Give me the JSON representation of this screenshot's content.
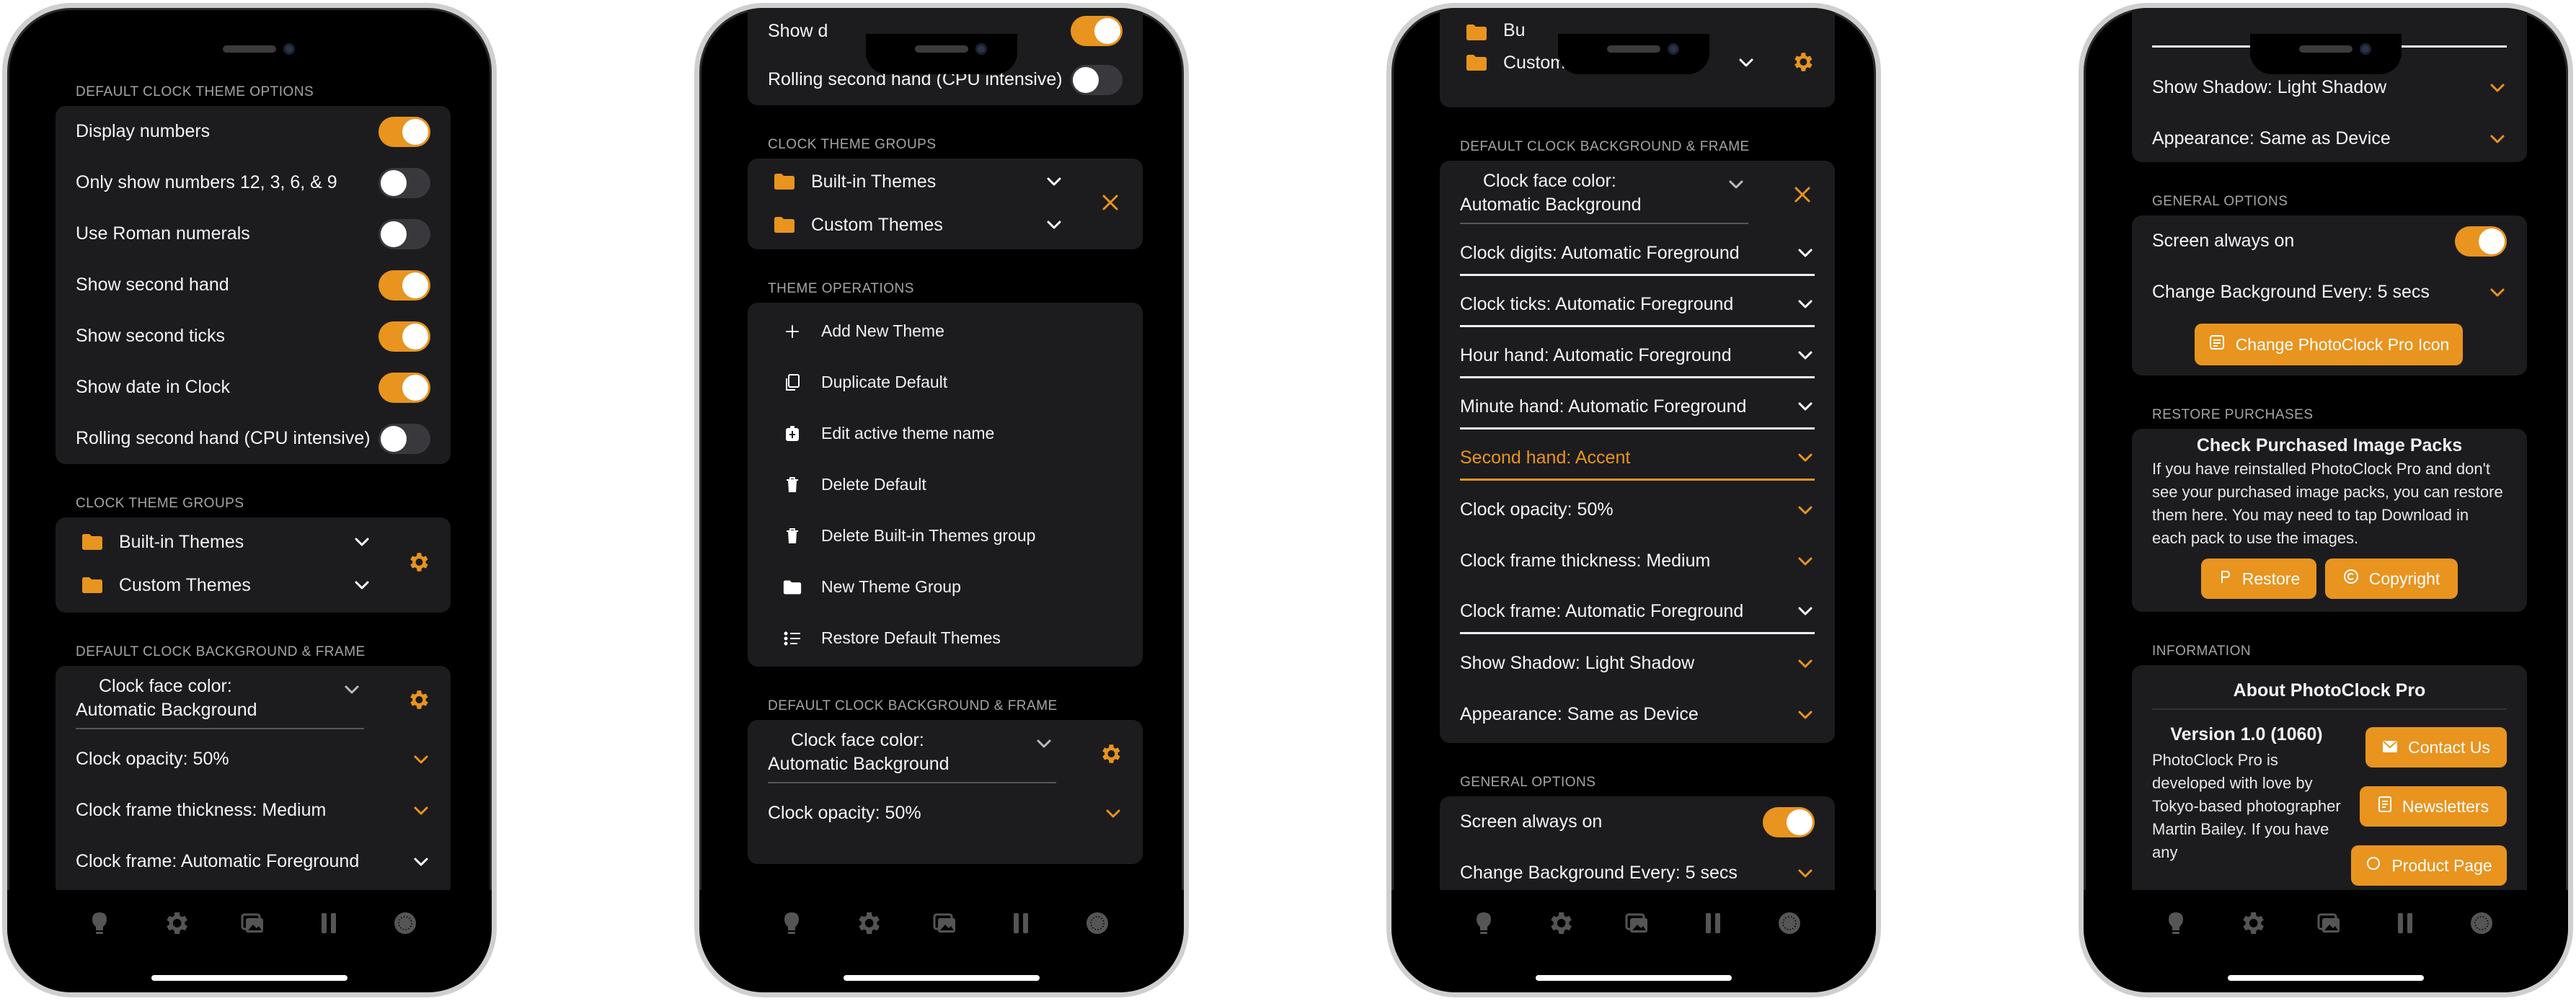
{
  "accent": "#e8941f",
  "phone1": {
    "default_theme_header": "DEFAULT CLOCK THEME OPTIONS",
    "toggles": [
      {
        "label": "Display numbers",
        "on": true
      },
      {
        "label": "Only show numbers 12, 3, 6, & 9",
        "on": false
      },
      {
        "label": "Use Roman numerals",
        "on": false
      },
      {
        "label": "Show second hand",
        "on": true
      },
      {
        "label": "Show second ticks",
        "on": true
      },
      {
        "label": "Show date in Clock",
        "on": true
      },
      {
        "label": "Rolling second hand (CPU intensive)",
        "on": false
      }
    ],
    "groups_header": "CLOCK THEME GROUPS",
    "groups": [
      "Built-in Themes",
      "Custom Themes"
    ],
    "bg_header": "DEFAULT CLOCK BACKGROUND & FRAME",
    "face_color_line1": "Clock face color:",
    "face_color_line2": "Automatic Background",
    "opacity": "Clock opacity: 50%",
    "frame_thickness": "Clock frame thickness: Medium",
    "frame": "Clock frame: Automatic Foreground"
  },
  "phone2": {
    "partial_top": "Show d",
    "rolling": "Rolling second hand (CPU intensive)",
    "groups_header": "CLOCK THEME GROUPS",
    "groups": [
      "Built-in Themes",
      "Custom Themes"
    ],
    "ops_header": "THEME OPERATIONS",
    "operations": [
      {
        "label": "Add New Theme",
        "icon": "plus-icon"
      },
      {
        "label": "Duplicate Default",
        "icon": "duplicate-icon"
      },
      {
        "label": "Edit active theme name",
        "icon": "edit-icon"
      },
      {
        "label": "Delete Default",
        "icon": "trash-icon"
      },
      {
        "label": "Delete Built-in Themes group",
        "icon": "trash-icon"
      },
      {
        "label": "New Theme Group",
        "icon": "folder-icon"
      },
      {
        "label": "Restore Default Themes",
        "icon": "restore-list-icon"
      }
    ],
    "bg_header": "DEFAULT CLOCK BACKGROUND & FRAME",
    "face_color_line1": "Clock face color:",
    "face_color_line2": "Automatic Background",
    "opacity": "Clock opacity: 50%"
  },
  "phone3": {
    "partial_group": "Bu",
    "custom_group": "Custom Themes",
    "bg_header": "DEFAULT CLOCK BACKGROUND & FRAME",
    "face_color_line1": "Clock face color:",
    "face_color_line2": "Automatic Background",
    "rows": [
      {
        "label": "Clock digits: Automatic Foreground",
        "style": "white"
      },
      {
        "label": "Clock ticks: Automatic Foreground",
        "style": "white"
      },
      {
        "label": "Hour hand: Automatic Foreground",
        "style": "white"
      },
      {
        "label": "Minute hand: Automatic Foreground",
        "style": "white"
      },
      {
        "label": "Second hand: Accent",
        "style": "accent"
      },
      {
        "label": "Clock opacity: 50%",
        "style": "plain"
      },
      {
        "label": "Clock frame thickness: Medium",
        "style": "plain"
      },
      {
        "label": "Clock frame: Automatic Foreground",
        "style": "white"
      },
      {
        "label": "Show Shadow: Light Shadow",
        "style": "plain"
      },
      {
        "label": "Appearance: Same as Device",
        "style": "plain"
      }
    ],
    "general_header": "GENERAL OPTIONS",
    "screen_on": "Screen always on",
    "change_bg_partial": "Change Background Every: 5 secs"
  },
  "phone4": {
    "shadow": "Show Shadow: Light Shadow",
    "appearance": "Appearance: Same as Device",
    "general_header": "GENERAL OPTIONS",
    "screen_on": "Screen always on",
    "change_bg": "Change Background Every: 5 secs",
    "change_icon_btn": "Change PhotoClock Pro Icon",
    "restore_header": "RESTORE PURCHASES",
    "check_title": "Check Purchased Image Packs",
    "check_text": "If you have reinstalled PhotoClock Pro and don't see your purchased image packs, you can restore them here. You may need to tap Download in each pack to use the images.",
    "restore_btn": "Restore",
    "copyright_btn": "Copyright",
    "info_header": "INFORMATION",
    "about_title": "About PhotoClock Pro",
    "version": "Version 1.0 (1060)",
    "about_text": "PhotoClock Pro is developed with love by Tokyo-based photographer Martin Bailey. If you have any",
    "contact_btn": "Contact Us",
    "newsletters_btn": "Newsletters",
    "third_btn_partial": "Product Page"
  },
  "tabbar_icons": [
    "bulb-icon",
    "gear-icon",
    "photos-icon",
    "pause-icon",
    "clock-icon"
  ]
}
